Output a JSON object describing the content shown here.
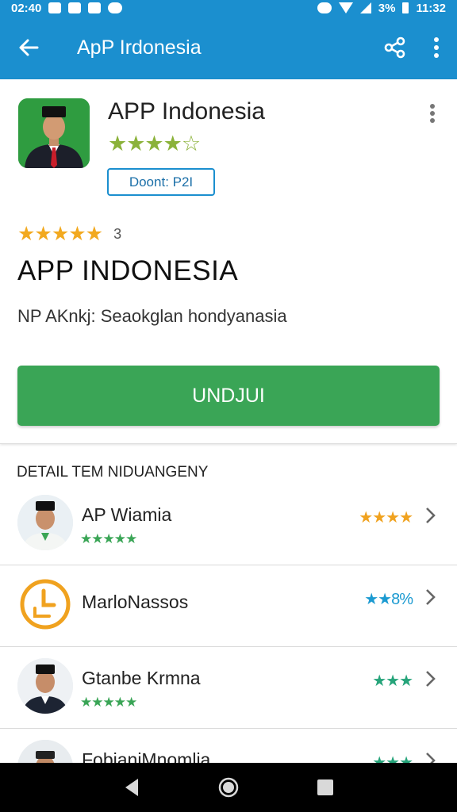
{
  "status_bar": {
    "time_left": "02:40",
    "battery": "3%",
    "time_right": "11:32"
  },
  "app_bar": {
    "title": "ApP Irdonesia",
    "back_icon": "arrow-left-icon",
    "share_icon": "share-icon",
    "menu_icon": "more-vert-icon"
  },
  "header": {
    "app_name": "APP Indonesia",
    "stars": "★★★★☆",
    "developer_badge": "Doont: P2I",
    "rating_stars": "★★★★★",
    "rating_count": "3",
    "title": "APP INDONESIA",
    "description": "NP AKnkj: Seaokglan hondyanasia",
    "install_label": "UNDJUI"
  },
  "section": {
    "heading": "DETAIL TEM NIDUANGENY"
  },
  "items": [
    {
      "name": "AP Wiamia",
      "stars": "★★★★★",
      "rating": "★★★★",
      "rating_color": "#f0a21f"
    },
    {
      "name": "MarloNassos",
      "stars": "",
      "rating": "★★8%",
      "rating_color": "#1b9ad1"
    },
    {
      "name": "Gtanbe Krmna",
      "stars": "★★★★★",
      "rating": "★★★",
      "rating_color": "#26a47a"
    },
    {
      "name": "FobianiMnomlia",
      "stars": "",
      "rating": "★★★",
      "rating_color": "#26a47a"
    }
  ],
  "colors": {
    "primary": "#1b8fcf",
    "install_green": "#3aa556",
    "star_gold": "#f2a91f"
  }
}
